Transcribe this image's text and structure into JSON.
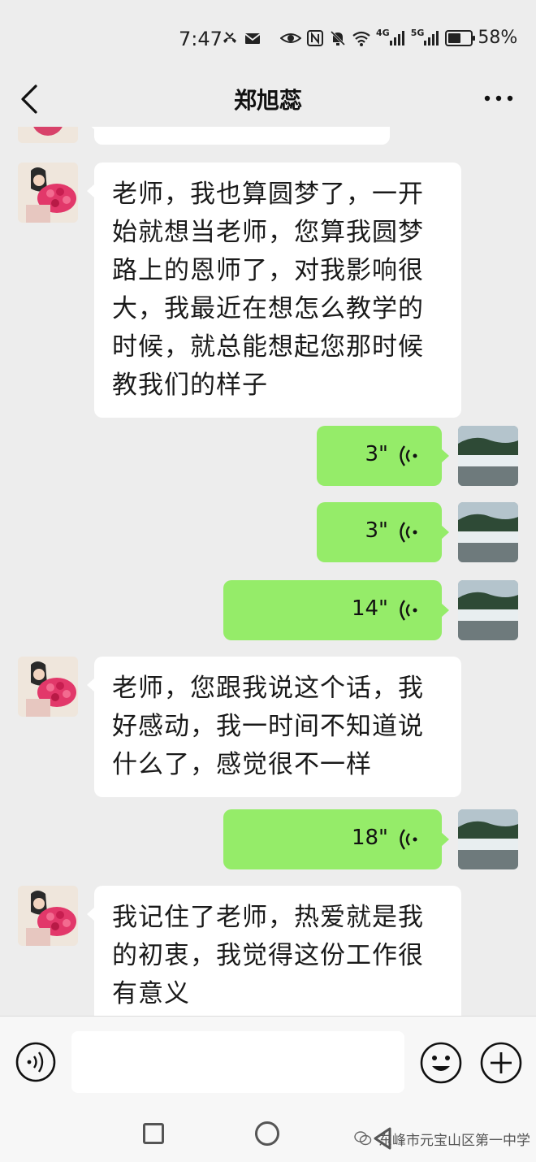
{
  "status_bar": {
    "time": "7:47",
    "battery_percent": "58%",
    "battery_level": 0.58,
    "net_4g": "4G",
    "net_5g": "5G"
  },
  "header": {
    "title": "郑旭蕊",
    "back_icon": "chevron-left-icon",
    "more_icon": "more-dots-icon"
  },
  "messages": [
    {
      "type": "text",
      "from": "contact",
      "lines": [
        "老师，我也算圆梦了，一开",
        "始就想当老师，您算我圆梦",
        "路上的恩师了，对我影响很",
        "大，我最近在想怎么教学的",
        "时候，就总能想起您那时候",
        "教我们的样子"
      ]
    },
    {
      "type": "voice",
      "from": "me",
      "duration": "3\""
    },
    {
      "type": "voice",
      "from": "me",
      "duration": "3\""
    },
    {
      "type": "voice",
      "from": "me",
      "duration": "14\""
    },
    {
      "type": "text",
      "from": "contact",
      "lines": [
        "老师，您跟我说这个话，我",
        "好感动，我一时间不知道说",
        "什么了，感觉很不一样"
      ]
    },
    {
      "type": "voice",
      "from": "me",
      "duration": "18\""
    },
    {
      "type": "text",
      "from": "contact",
      "lines": [
        "我记住了老师，热爱就是我",
        "的初衷，我觉得这份工作很",
        "有意义"
      ]
    }
  ],
  "input_bar": {
    "placeholder": "",
    "voice_icon": "voice-mode-icon",
    "emoji_icon": "emoji-icon",
    "plus_icon": "plus-icon"
  },
  "watermark": "东峰市元宝山区第一中学",
  "colors": {
    "background": "#ededed",
    "outgoing_bubble": "#95ec69",
    "incoming_bubble": "#ffffff"
  }
}
